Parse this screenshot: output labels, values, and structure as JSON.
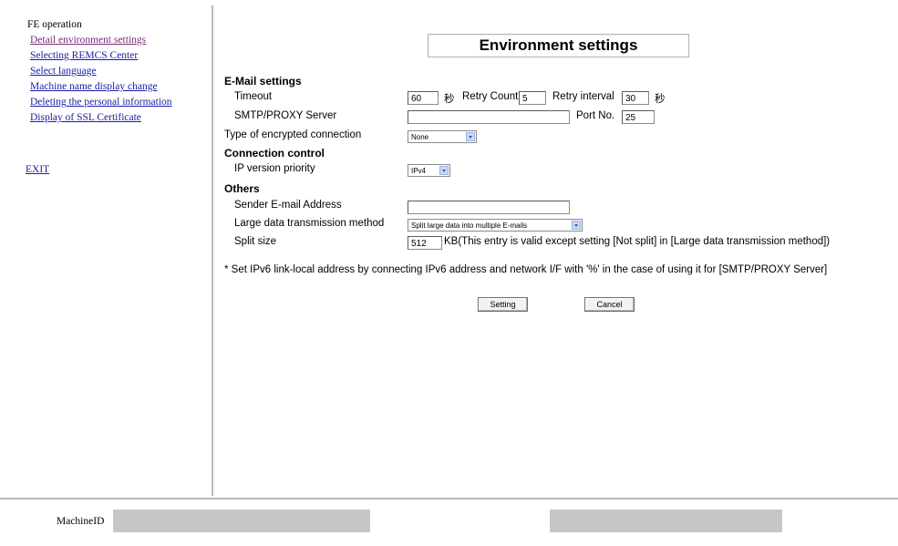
{
  "sidebar": {
    "title": "FE operation",
    "links": [
      "Detail environment settings",
      "Selecting REMCS Center",
      "Select language",
      "Machine name display change",
      "Deleting the personal information",
      "Display of SSL Certificate"
    ],
    "exit": "EXIT"
  },
  "page": {
    "title": "Environment settings"
  },
  "email": {
    "section": "E-Mail settings",
    "timeout_label": "Timeout",
    "timeout_value": "60",
    "timeout_unit": "秒",
    "retry_count_label": "Retry Count",
    "retry_count_value": "5",
    "retry_interval_label": "Retry interval",
    "retry_interval_value": "30",
    "retry_interval_unit": "秒",
    "smtp_label": "SMTP/PROXY Server",
    "smtp_value": "",
    "port_label": "Port No.",
    "port_value": "25"
  },
  "encryption": {
    "label": "Type of encrypted connection",
    "selected": "None"
  },
  "connection": {
    "section": "Connection control",
    "ip_label": "IP version priority",
    "ip_selected": "IPv4"
  },
  "others": {
    "section": "Others",
    "sender_label": "Sender E-mail Address",
    "sender_value": "",
    "large_label": "Large data transmission method",
    "large_selected": "Split large data into multiple E-mails",
    "split_label": "Split size",
    "split_value": "512",
    "split_note": "KB(This entry is valid except setting [Not split] in [Large data transmission method])"
  },
  "note": "* Set IPv6 link-local address by connecting IPv6 address and network I/F with '%' in the case of using it for [SMTP/PROXY Server]",
  "buttons": {
    "setting": "Setting",
    "cancel": "Cancel"
  },
  "footer": {
    "machine_label": "MachineID"
  }
}
